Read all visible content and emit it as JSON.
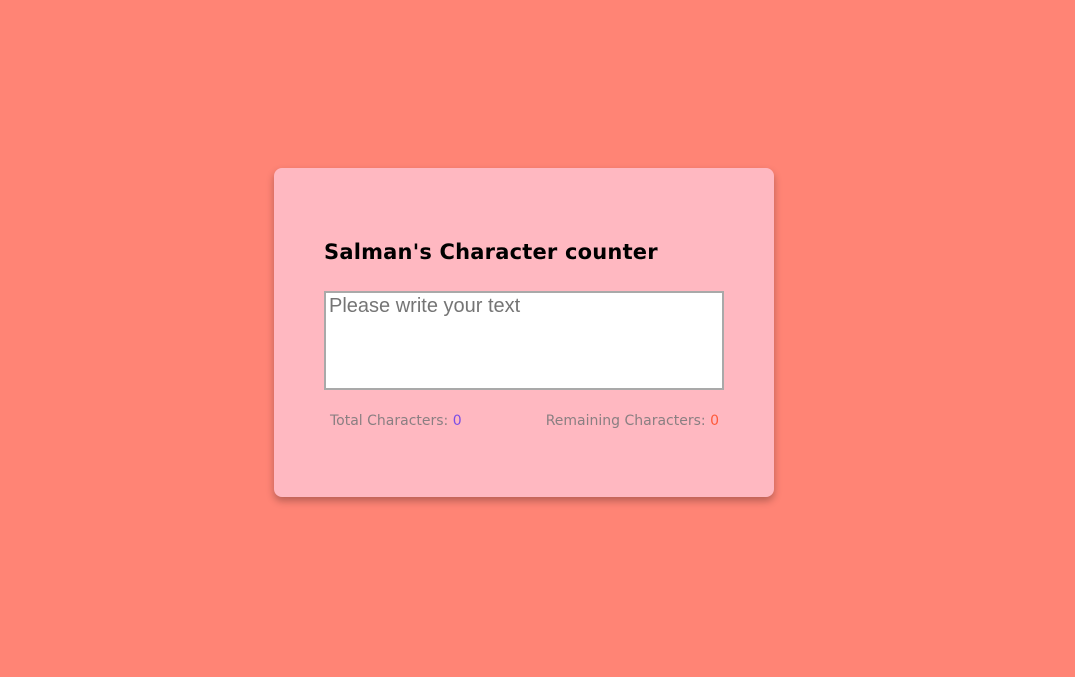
{
  "app": {
    "title": "Salman's Character counter"
  },
  "input": {
    "value": "",
    "placeholder": "Please write your text"
  },
  "stats": {
    "total_label": "Total Characters:",
    "total_value": "0",
    "remaining_label": "Remaining Characters:",
    "remaining_value": "0"
  },
  "colors": {
    "page_background": "#ff8475",
    "card_background": "#ffb8c1",
    "total_value_color": "#7b4ee6",
    "remaining_value_color": "#ff5a3a",
    "label_color": "#8a7f82"
  }
}
